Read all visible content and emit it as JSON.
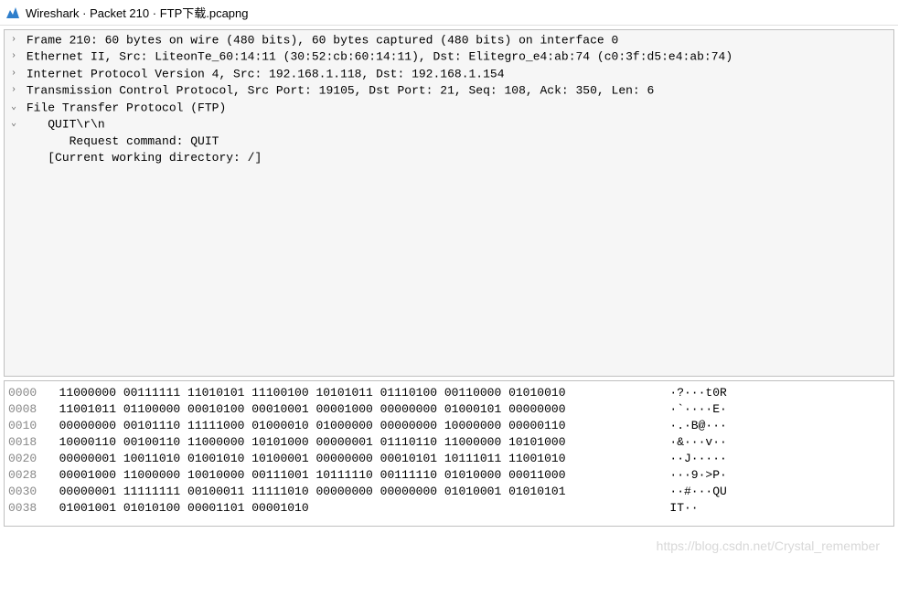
{
  "title": {
    "app": "Wireshark",
    "packet": "Packet 210",
    "file": "FTP下载.pcapng"
  },
  "details": {
    "lines": [
      {
        "expand": "collapsed",
        "indent": 0,
        "text": "Frame 210: 60 bytes on wire (480 bits), 60 bytes captured (480 bits) on interface 0"
      },
      {
        "expand": "collapsed",
        "indent": 0,
        "text": "Ethernet II, Src: LiteonTe_60:14:11 (30:52:cb:60:14:11), Dst: Elitegro_e4:ab:74 (c0:3f:d5:e4:ab:74)"
      },
      {
        "expand": "collapsed",
        "indent": 0,
        "text": "Internet Protocol Version 4, Src: 192.168.1.118, Dst: 192.168.1.154"
      },
      {
        "expand": "collapsed",
        "indent": 0,
        "text": "Transmission Control Protocol, Src Port: 19105, Dst Port: 21, Seq: 108, Ack: 350, Len: 6"
      },
      {
        "expand": "expanded",
        "indent": 0,
        "text": "File Transfer Protocol (FTP)"
      },
      {
        "expand": "expanded",
        "indent": 1,
        "text": "QUIT\\r\\n"
      },
      {
        "expand": "none",
        "indent": 2,
        "text": "Request command: QUIT"
      },
      {
        "expand": "none",
        "indent": 1,
        "text": "[Current working directory: /]"
      }
    ]
  },
  "bytes": {
    "rows": [
      {
        "offset": "0000",
        "bits": "11000000 00111111 11010101 11100100 10101011 01110100 00110000 01010010",
        "ascii": "·?···t0R"
      },
      {
        "offset": "0008",
        "bits": "11001011 01100000 00010100 00010001 00001000 00000000 01000101 00000000",
        "ascii": "·`····E·"
      },
      {
        "offset": "0010",
        "bits": "00000000 00101110 11111000 01000010 01000000 00000000 10000000 00000110",
        "ascii": "·.·B@···"
      },
      {
        "offset": "0018",
        "bits": "10000110 00100110 11000000 10101000 00000001 01110110 11000000 10101000",
        "ascii": "·&···v··"
      },
      {
        "offset": "0020",
        "bits": "00000001 10011010 01001010 10100001 00000000 00010101 10111011 11001010",
        "ascii": "··J·····"
      },
      {
        "offset": "0028",
        "bits": "00001000 11000000 10010000 00111001 10111110 00111110 01010000 00011000",
        "ascii": "···9·>P·"
      },
      {
        "offset": "0030",
        "bits": "00000001 11111111 00100011 11111010 00000000 00000000 01010001 01010101",
        "ascii": "··#···QU"
      },
      {
        "offset": "0038",
        "bits": "01001001 01010100 00001101 00001010",
        "ascii": "IT··"
      }
    ]
  },
  "watermark": "https://blog.csdn.net/Crystal_remember"
}
